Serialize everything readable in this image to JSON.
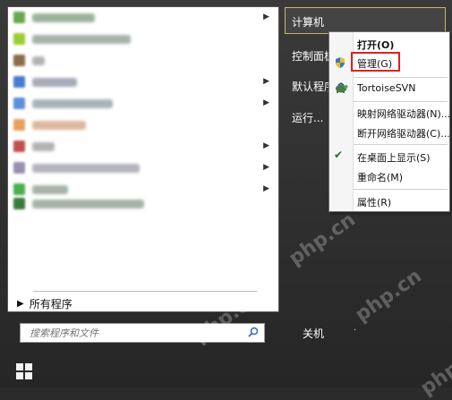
{
  "start_menu": {
    "all_programs_label": "所有程序",
    "search_placeholder": "搜索程序和文件",
    "shutdown_label": "关机",
    "right_items": {
      "computer": "计算机",
      "control_panel": "控制面板",
      "default_programs": "默认程序",
      "run": "运行..."
    }
  },
  "program_colors": [
    "#6aa84f",
    "#9acd32",
    "#8b6b4a",
    "#4a7bd0",
    "#5b8fd9",
    "#e8a060",
    "#c05050",
    "#9a8fb0",
    "#4caf50",
    "#3a7a3a"
  ],
  "context_menu": {
    "items": [
      {
        "label": "打开(O)",
        "bold": true
      },
      {
        "label": "管理(G)"
      },
      {
        "label": "TortoiseSVN"
      },
      {
        "label": "映射网络驱动器(N)..."
      },
      {
        "label": "断开网络驱动器(C)..."
      },
      {
        "label": "在桌面上显示(S)"
      },
      {
        "label": "重命名(M)"
      },
      {
        "label": "属性(R)"
      }
    ]
  },
  "watermark": "php.cn"
}
